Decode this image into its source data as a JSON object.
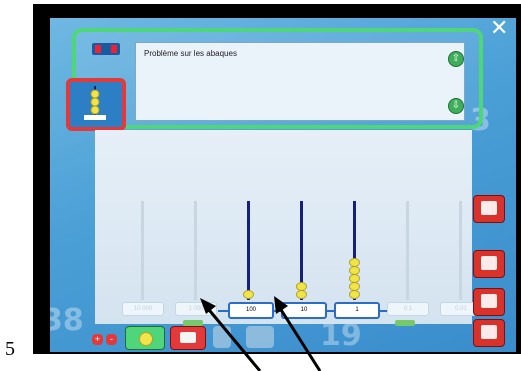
{
  "title": {
    "text": "Problème sur les abaques"
  },
  "nav": {
    "up_icon": "up-arrow-icon",
    "down_icon": "down-arrow-icon",
    "up_glyph": "⇧",
    "down_glyph": "⇩",
    "close_glyph": "✕"
  },
  "abacus": {
    "columns": [
      {
        "label": "10 000",
        "beads": 0,
        "active": false
      },
      {
        "label": "1 000",
        "beads": 0,
        "active": false
      },
      {
        "label": "100",
        "beads": 1,
        "active": true
      },
      {
        "label": "10",
        "beads": 2,
        "active": true
      },
      {
        "label": "1",
        "beads": 5,
        "active": true
      },
      {
        "label": "0.1",
        "beads": 0,
        "active": false
      },
      {
        "label": "0.01",
        "beads": 0,
        "active": false
      }
    ]
  },
  "bottom": {
    "plus": "+",
    "minus": "-"
  },
  "page_number": "5",
  "colors": {
    "accent_green": "#4fd67a",
    "accent_red": "#e23a3a",
    "background": "#4a9fd6"
  },
  "icons": [
    "megaphone-icon",
    "pencil-icon",
    "calendar-icon",
    "trash-icon",
    "eraser-icon",
    "bead-icon"
  ]
}
